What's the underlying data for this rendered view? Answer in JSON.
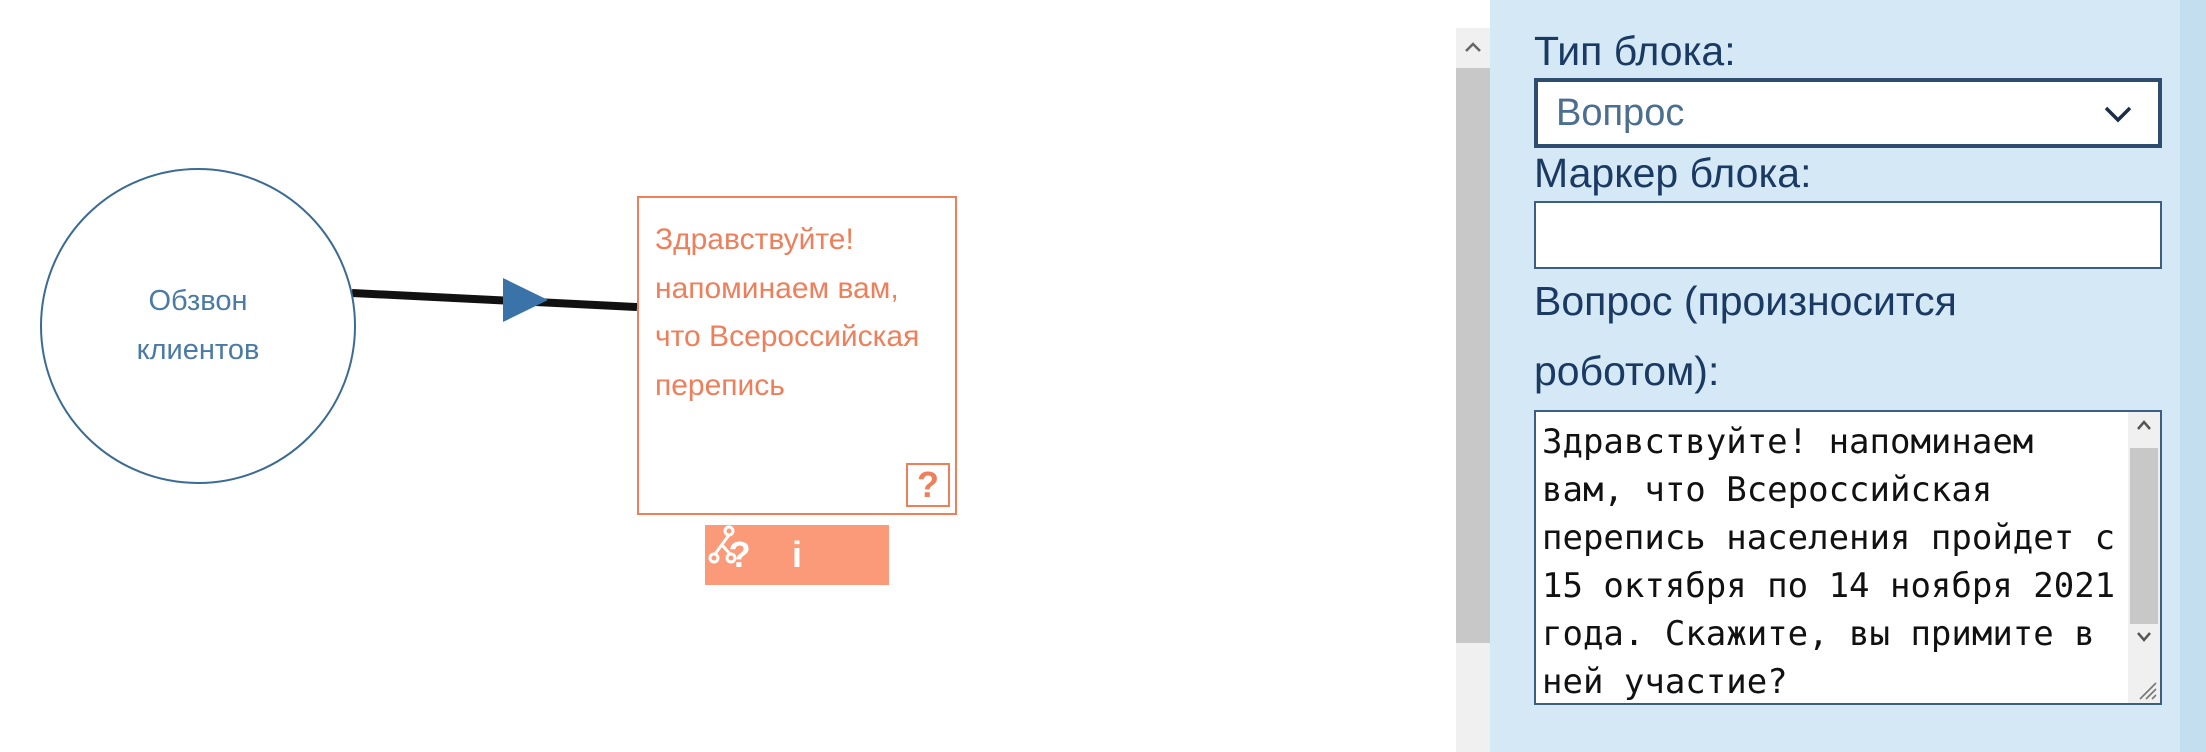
{
  "canvas": {
    "start_node": {
      "label": "Обзвон клиентов"
    },
    "question_node": {
      "text": "Здравствуйте! напоминаем вам, что Всероссийская перепись",
      "badge": "?"
    },
    "toolbar": {
      "question_btn": "?",
      "info_btn": "i",
      "branch_icon": "branch-icon"
    },
    "colors": {
      "start": "#3b6b94",
      "question": "#ee7f5a",
      "toolbar": "#fb9a78",
      "arrow": "#3a73a8"
    }
  },
  "panel": {
    "block_type_label": "Тип блока:",
    "block_type_value": "Вопрос",
    "marker_label": "Маркер блока:",
    "marker_value": "",
    "question_label_line1": "Вопрос (произносится",
    "question_label_line2": "роботом):",
    "question_text": "Здравствуйте! напоминаем вам, что Всероссийская перепись населения пройдет с 15 октября по 14 ноября 2021 года. Скажите, вы примите в ней участие?",
    "colors": {
      "background": "#d4e9f5",
      "label": "#1b3a63"
    }
  }
}
